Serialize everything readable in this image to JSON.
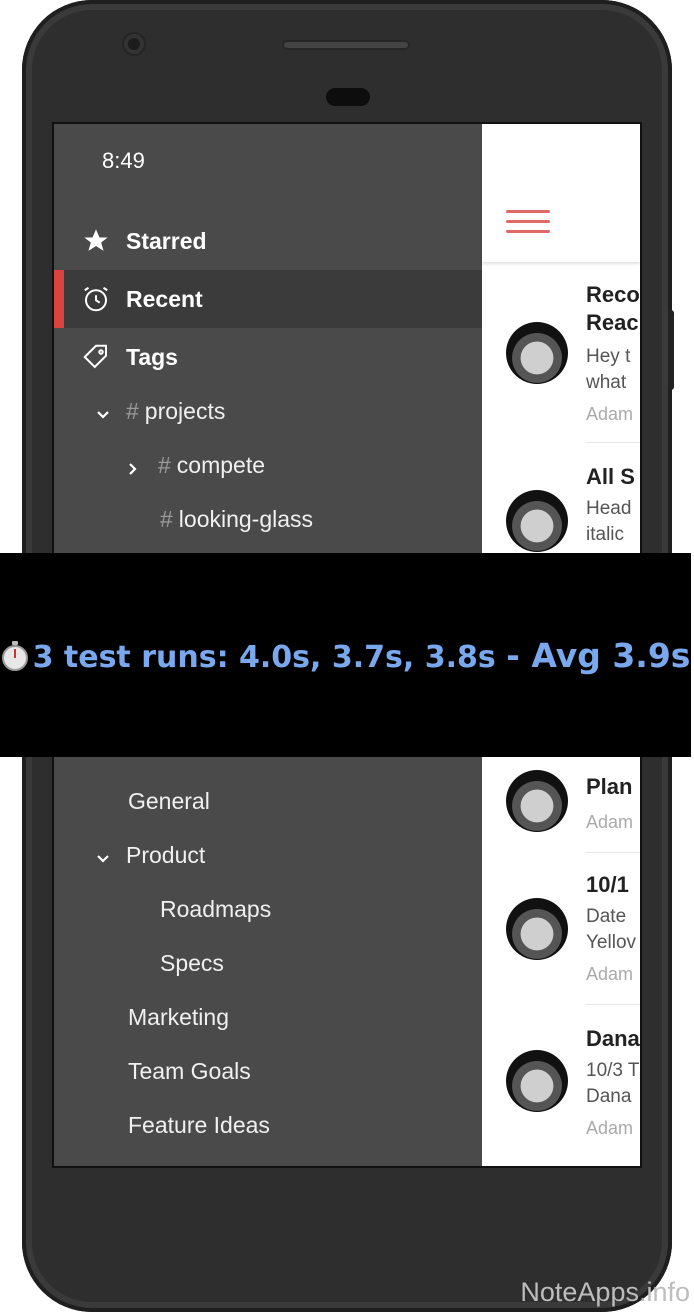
{
  "status": {
    "time": "8:49"
  },
  "drawer": {
    "nav": [
      {
        "label": "Starred",
        "icon": "star-icon"
      },
      {
        "label": "Recent",
        "icon": "alarm-clock-icon",
        "active": true
      },
      {
        "label": "Tags",
        "icon": "tag-icon"
      }
    ],
    "tags": [
      {
        "label": "projects",
        "hash": "#"
      },
      {
        "label": "compete",
        "hash": "#"
      },
      {
        "label": "looking-glass",
        "hash": "#"
      }
    ],
    "folders": [
      {
        "label": "General"
      },
      {
        "label": "Product"
      },
      {
        "label": "Roadmaps"
      },
      {
        "label": "Specs"
      },
      {
        "label": "Marketing"
      },
      {
        "label": "Team Goals"
      },
      {
        "label": "Feature Ideas"
      }
    ]
  },
  "notes": [
    {
      "title1": "Reco",
      "title2": "Reac",
      "body1": "Hey t",
      "body2": "what",
      "author": "Adam"
    },
    {
      "title1": "All S",
      "body1": "Head",
      "body2": "italic"
    },
    {
      "title1": "Plan",
      "author": "Adam"
    },
    {
      "title1": "10/1",
      "body1": "Date",
      "body2": "Yellov",
      "author": "Adam"
    },
    {
      "title1": "Dana",
      "body1": "10/3 T",
      "body2": "Dana",
      "author": "Adam"
    }
  ],
  "banner": {
    "runs_text": "3 test runs:  4.0s, 3.7s, 3.8s",
    "avg_text": "- Avg 3.9s"
  },
  "watermark": "NoteApps.info",
  "colors": {
    "accent": "#d9443f",
    "drawer_bg": "#4a4a4a",
    "banner_text": "#7aa8ee"
  }
}
